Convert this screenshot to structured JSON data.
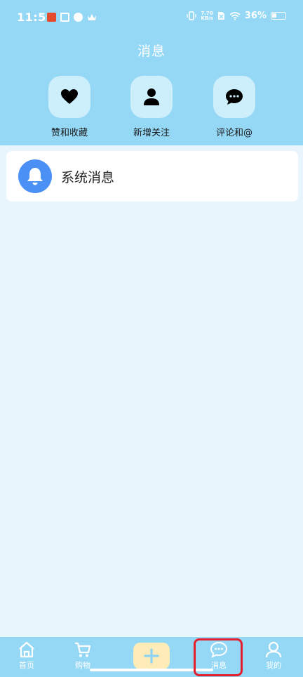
{
  "status_bar": {
    "time": "11:59",
    "speed_value": "7.70",
    "speed_unit": "KB/s",
    "battery": "36%"
  },
  "header": {
    "title": "消息"
  },
  "quick_actions": [
    {
      "label": "赞和收藏",
      "icon": "heart-icon"
    },
    {
      "label": "新增关注",
      "icon": "person-icon"
    },
    {
      "label": "评论和@",
      "icon": "chat-bubble-icon"
    }
  ],
  "messages": [
    {
      "label": "系统消息",
      "icon": "bell-icon"
    }
  ],
  "bottom_nav": {
    "items": [
      {
        "label": "首页",
        "icon": "home-icon"
      },
      {
        "label": "购物",
        "icon": "cart-icon"
      },
      {
        "label": "",
        "icon": "plus-icon"
      },
      {
        "label": "消息",
        "icon": "message-icon",
        "active": true
      },
      {
        "label": "我的",
        "icon": "profile-icon"
      }
    ]
  },
  "colors": {
    "header_bg": "#94d8f6",
    "page_bg": "#e8f5fc",
    "tile_bg": "#cdeefb",
    "bell_bg": "#4b90f5",
    "add_button_bg": "#fdebb8",
    "highlight": "#e41e2c"
  }
}
